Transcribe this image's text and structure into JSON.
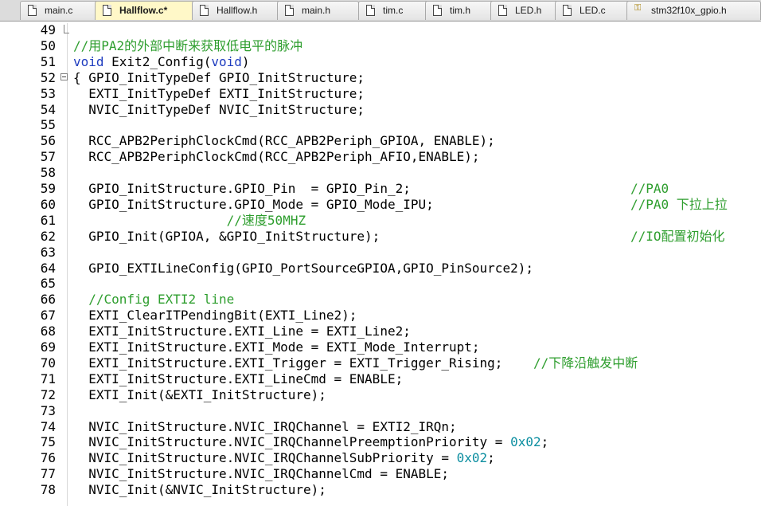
{
  "tabs": [
    {
      "label": "main.c",
      "active": false
    },
    {
      "label": "Hallflow.c*",
      "active": true
    },
    {
      "label": "Hallflow.h",
      "active": false
    },
    {
      "label": "main.h",
      "active": false
    },
    {
      "label": "tim.c",
      "active": false
    },
    {
      "label": "tim.h",
      "active": false
    },
    {
      "label": "LED.h",
      "active": false
    },
    {
      "label": "LED.c",
      "active": false
    },
    {
      "label": "stm32f10x_gpio.h",
      "active": false
    }
  ],
  "lines": [
    {
      "n": "49",
      "segs": []
    },
    {
      "n": "50",
      "segs": [
        {
          "t": "//用PA2的外部中断来获取低电平的脉冲",
          "c": "cmt"
        }
      ]
    },
    {
      "n": "51",
      "segs": [
        {
          "t": "void",
          "c": "kw"
        },
        {
          "t": " Exit2_Config(",
          "c": ""
        },
        {
          "t": "void",
          "c": "kw"
        },
        {
          "t": ")",
          "c": ""
        }
      ]
    },
    {
      "n": "52",
      "segs": [
        {
          "t": "{ GPIO_InitTypeDef GPIO_InitStructure;",
          "c": ""
        }
      ]
    },
    {
      "n": "53",
      "segs": [
        {
          "t": "  EXTI_InitTypeDef EXTI_InitStructure;",
          "c": ""
        }
      ]
    },
    {
      "n": "54",
      "segs": [
        {
          "t": "  NVIC_InitTypeDef NVIC_InitStructure;",
          "c": ""
        }
      ]
    },
    {
      "n": "55",
      "segs": []
    },
    {
      "n": "56",
      "segs": [
        {
          "t": "  RCC_APB2PeriphClockCmd(RCC_APB2Periph_GPIOA, ENABLE);",
          "c": ""
        }
      ]
    },
    {
      "n": "57",
      "segs": [
        {
          "t": "  RCC_APB2PeriphClockCmd(RCC_APB2Periph_AFIO,ENABLE);",
          "c": ""
        }
      ]
    },
    {
      "n": "58",
      "segs": []
    },
    {
      "n": "59",
      "segs": [
        {
          "t": "  GPIO_InitStructure.GPIO_Pin  = GPIO_Pin_2;",
          "c": ""
        }
      ],
      "right": "//PA0"
    },
    {
      "n": "60",
      "segs": [
        {
          "t": "  GPIO_InitStructure.GPIO_Mode = GPIO_Mode_IPU;",
          "c": ""
        }
      ],
      "right": "//PA0 下拉上拉"
    },
    {
      "n": "61",
      "segs": [
        {
          "t": "                    ",
          "c": ""
        },
        {
          "t": "//速度50MHZ",
          "c": "cmt"
        }
      ]
    },
    {
      "n": "62",
      "segs": [
        {
          "t": "  GPIO_Init(GPIOA, &GPIO_InitStructure);",
          "c": ""
        }
      ],
      "right": "//IO配置初始化"
    },
    {
      "n": "63",
      "segs": []
    },
    {
      "n": "64",
      "segs": [
        {
          "t": "  GPIO_EXTILineConfig(GPIO_PortSourceGPIOA,GPIO_PinSource2);",
          "c": ""
        }
      ]
    },
    {
      "n": "65",
      "segs": []
    },
    {
      "n": "66",
      "segs": [
        {
          "t": "  ",
          "c": ""
        },
        {
          "t": "//Config EXTI2 line",
          "c": "cmt"
        }
      ]
    },
    {
      "n": "67",
      "segs": [
        {
          "t": "  EXTI_ClearITPendingBit(EXTI_Line2);",
          "c": ""
        }
      ]
    },
    {
      "n": "68",
      "segs": [
        {
          "t": "  EXTI_InitStructure.EXTI_Line = EXTI_Line2;",
          "c": ""
        }
      ]
    },
    {
      "n": "69",
      "segs": [
        {
          "t": "  EXTI_InitStructure.EXTI_Mode = EXTI_Mode_Interrupt;",
          "c": ""
        }
      ]
    },
    {
      "n": "70",
      "segs": [
        {
          "t": "  EXTI_InitStructure.EXTI_Trigger = EXTI_Trigger_Rising;    ",
          "c": ""
        },
        {
          "t": "//下降沿触发中断",
          "c": "cmt"
        }
      ]
    },
    {
      "n": "71",
      "segs": [
        {
          "t": "  EXTI_InitStructure.EXTI_LineCmd = ENABLE;",
          "c": ""
        }
      ]
    },
    {
      "n": "72",
      "segs": [
        {
          "t": "  EXTI_Init(&EXTI_InitStructure);",
          "c": ""
        }
      ]
    },
    {
      "n": "73",
      "segs": []
    },
    {
      "n": "74",
      "segs": [
        {
          "t": "  NVIC_InitStructure.NVIC_IRQChannel = EXTI2_IRQn;",
          "c": ""
        }
      ]
    },
    {
      "n": "75",
      "segs": [
        {
          "t": "  NVIC_InitStructure.NVIC_IRQChannelPreemptionPriority = ",
          "c": ""
        },
        {
          "t": "0x02",
          "c": "num"
        },
        {
          "t": ";",
          "c": ""
        }
      ]
    },
    {
      "n": "76",
      "segs": [
        {
          "t": "  NVIC_InitStructure.NVIC_IRQChannelSubPriority = ",
          "c": ""
        },
        {
          "t": "0x02",
          "c": "num"
        },
        {
          "t": ";",
          "c": ""
        }
      ]
    },
    {
      "n": "77",
      "segs": [
        {
          "t": "  NVIC_InitStructure.NVIC_IRQChannelCmd = ENABLE;",
          "c": ""
        }
      ]
    },
    {
      "n": "78",
      "segs": [
        {
          "t": "  NVIC_Init(&NVIC_InitStructure);",
          "c": ""
        }
      ]
    }
  ],
  "colors": {
    "comment": "#2e9e2e",
    "keyword": "#1e3cbf",
    "number": "#0b8ea0",
    "active_tab": "#fff8c8"
  }
}
